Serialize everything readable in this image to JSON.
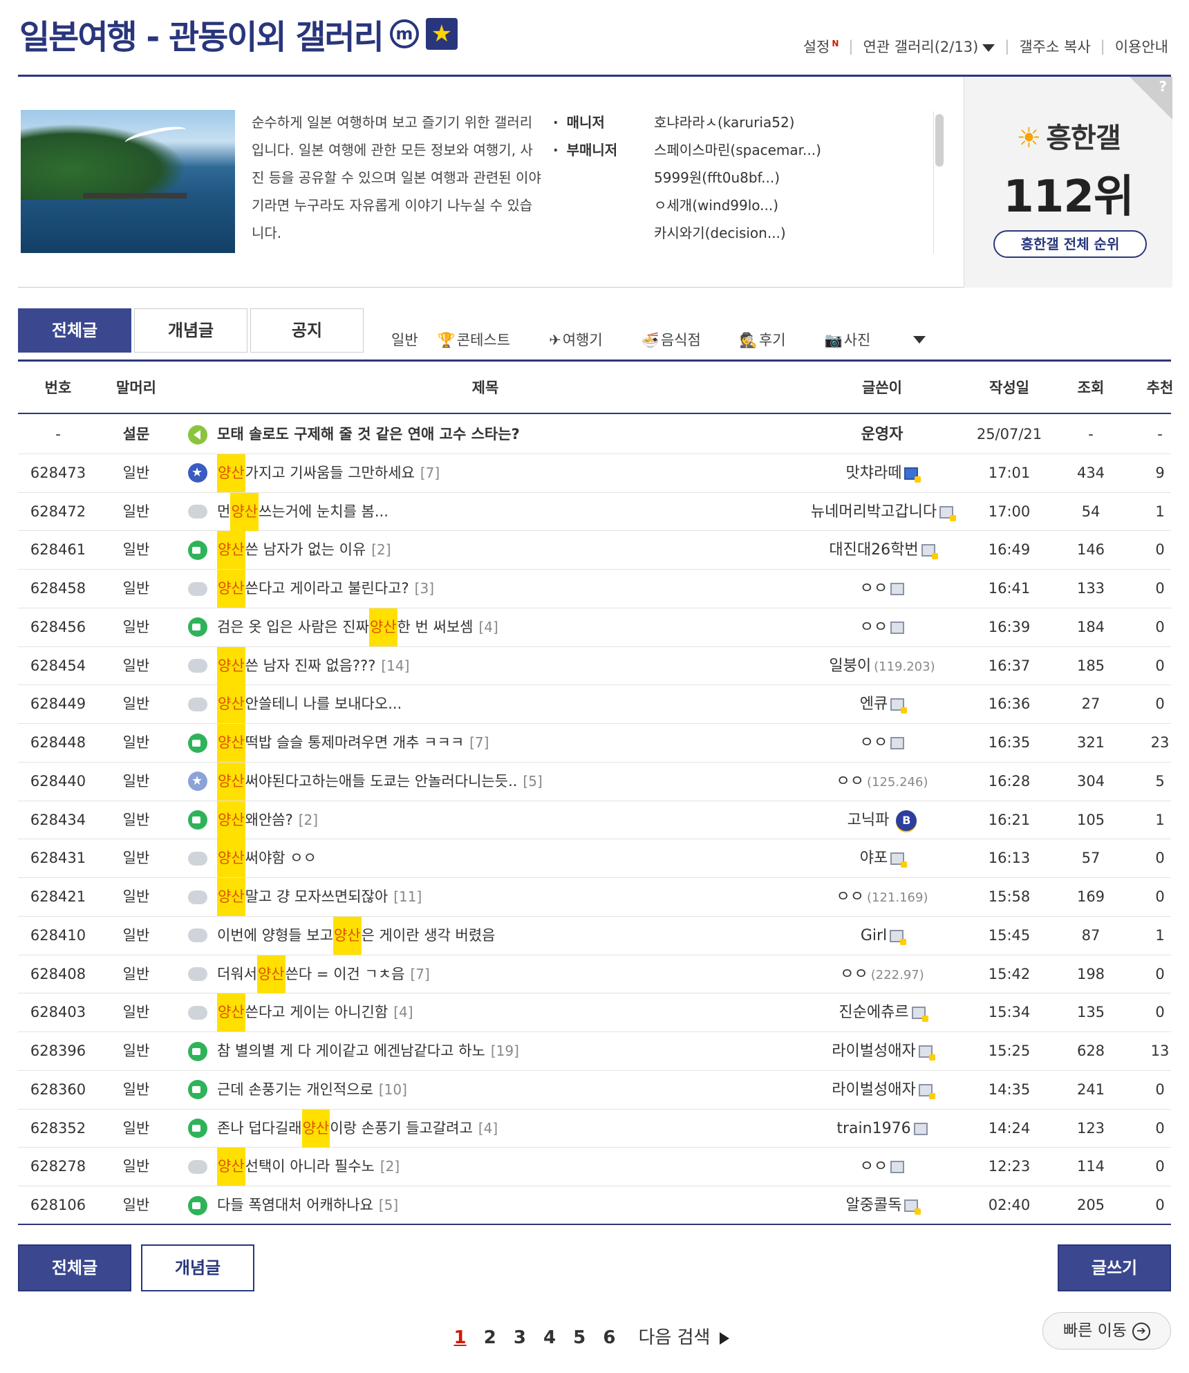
{
  "header": {
    "title": "일본여행 - 관동이외 갤러리",
    "badge_m": "m",
    "badge_star": "★",
    "links": [
      "설정",
      "연관 갤러리(2/13)",
      "갤주소 복사",
      "이용안내"
    ],
    "new_mark": "N",
    "link_sep": "|"
  },
  "info": {
    "description": "순수하게 일본 여행하며 보고 즐기기 위한 갤러리입니다. 일본 여행에 관한 모든 정보와 여행기, 사진 등을 공유할 수 있으며 일본 여행과 관련된 이야기라면 누구라도 자유롭게 이야기 나누실 수 있습니다.",
    "manager_label": "매니저",
    "submanager_label": "부매니저",
    "managers": [
      "호냐라라ㅅ(karuria52)",
      "스페이스마린(spacemar...)",
      "5999원(fft0u8bf...)",
      "ㅇ세개(wind99lo...)",
      "카시와기(decision...)"
    ]
  },
  "rank": {
    "question": "?",
    "sun_icon": "☀",
    "name": "흥한갤",
    "number": "112위",
    "button": "흥한갤 전체 순위"
  },
  "tabs": [
    "전체글",
    "개념글",
    "공지"
  ],
  "categories": [
    {
      "icon": "",
      "label": "일반"
    },
    {
      "icon": "🏆",
      "label": "콘테스트"
    },
    {
      "icon": "✈",
      "label": "여행기"
    },
    {
      "icon": "🍜",
      "label": "음식점"
    },
    {
      "icon": "🕵",
      "label": "후기"
    },
    {
      "icon": "📷",
      "label": "사진"
    }
  ],
  "table": {
    "headers": {
      "no": "번호",
      "head": "말머리",
      "title": "제목",
      "writer": "글쓴이",
      "date": "작성일",
      "views": "조회",
      "rec": "추천"
    },
    "rows": [
      {
        "no": "-",
        "head": "설문",
        "icon": "speaker",
        "pre": "",
        "hl": "",
        "post": "모태 솔로도 구제해 줄 것 같은 연애 고수 스타는?",
        "cmt": "",
        "writer": "운영자",
        "ip": "",
        "fix": "",
        "date": "25/07/21",
        "views": "-",
        "rec": "-",
        "notice": true
      },
      {
        "no": "628473",
        "head": "일반",
        "icon": "star",
        "pre": "",
        "hl": "양산",
        "post": "가지고 기싸움들 그만하세요",
        "cmt": "[7]",
        "writer": "맛챠라떼",
        "ip": "",
        "fix": "blue",
        "date": "17:01",
        "views": "434",
        "rec": "9"
      },
      {
        "no": "628472",
        "head": "일반",
        "icon": "chat",
        "pre": "먼 ",
        "hl": "양산",
        "post": "쓰는거에 눈치를 봄...",
        "cmt": "",
        "writer": "뉴네머리박고갑니다",
        "ip": "",
        "fix": "yellow",
        "date": "17:00",
        "views": "54",
        "rec": "1"
      },
      {
        "no": "628461",
        "head": "일반",
        "icon": "pic",
        "pre": "",
        "hl": "양산",
        "post": " 쓴 남자가 없는 이유",
        "cmt": "[2]",
        "writer": "대진대26학번",
        "ip": "",
        "fix": "yellow",
        "date": "16:49",
        "views": "146",
        "rec": "0"
      },
      {
        "no": "628458",
        "head": "일반",
        "icon": "chat",
        "pre": "",
        "hl": "양산",
        "post": " 쓴다고 게이라고 불린다고?",
        "cmt": "[3]",
        "writer": "ㅇㅇ",
        "ip": "",
        "fix": "gray",
        "date": "16:41",
        "views": "133",
        "rec": "0"
      },
      {
        "no": "628456",
        "head": "일반",
        "icon": "pic",
        "pre": "검은 옷 입은 사람은 진짜 ",
        "hl": "양산",
        "post": " 한 번 써보셈",
        "cmt": "[4]",
        "writer": "ㅇㅇ",
        "ip": "",
        "fix": "gray",
        "date": "16:39",
        "views": "184",
        "rec": "0"
      },
      {
        "no": "628454",
        "head": "일반",
        "icon": "chat",
        "pre": "",
        "hl": "양산",
        "post": " 쓴 남자 진짜 없음???",
        "cmt": "[14]",
        "writer": "일붕이",
        "ip": "(119.203)",
        "fix": "",
        "date": "16:37",
        "views": "185",
        "rec": "0"
      },
      {
        "no": "628449",
        "head": "일반",
        "icon": "chat",
        "pre": "",
        "hl": "양산",
        "post": "안쓸테니 나를 보내다오...",
        "cmt": "",
        "writer": "엔큐",
        "ip": "",
        "fix": "yellow",
        "date": "16:36",
        "views": "27",
        "rec": "0"
      },
      {
        "no": "628448",
        "head": "일반",
        "icon": "pic",
        "pre": "",
        "hl": "양산",
        "post": " 떡밥 슬슬 통제마려우면 개추 ㅋㅋㅋ",
        "cmt": "[7]",
        "writer": "ㅇㅇ",
        "ip": "",
        "fix": "gray",
        "date": "16:35",
        "views": "321",
        "rec": "23"
      },
      {
        "no": "628440",
        "head": "일반",
        "icon": "star-light",
        "pre": "",
        "hl": "양산",
        "post": "써야된다고하는애들 도쿄는 안놀러다니는듯..",
        "cmt": "[5]",
        "writer": "ㅇㅇ",
        "ip": "(125.246)",
        "fix": "",
        "date": "16:28",
        "views": "304",
        "rec": "5"
      },
      {
        "no": "628434",
        "head": "일반",
        "icon": "pic",
        "pre": "",
        "hl": "양산",
        "post": " 왜안씀?",
        "cmt": "[2]",
        "writer": "고닉파",
        "ip": "",
        "fix": "",
        "badge": "B",
        "date": "16:21",
        "views": "105",
        "rec": "1"
      },
      {
        "no": "628431",
        "head": "일반",
        "icon": "chat",
        "pre": "",
        "hl": "양산",
        "post": " 써야함 ㅇㅇ",
        "cmt": "",
        "writer": "야포",
        "ip": "",
        "fix": "yellow",
        "date": "16:13",
        "views": "57",
        "rec": "0"
      },
      {
        "no": "628421",
        "head": "일반",
        "icon": "chat",
        "pre": "",
        "hl": "양산",
        "post": "말고 걍 모자쓰면되잖아",
        "cmt": "[11]",
        "writer": "ㅇㅇ",
        "ip": "(121.169)",
        "fix": "",
        "date": "15:58",
        "views": "169",
        "rec": "0"
      },
      {
        "no": "628410",
        "head": "일반",
        "icon": "chat",
        "pre": "이번에 양형들 보고 ",
        "hl": "양산",
        "post": "은 게이란 생각 버렸음",
        "cmt": "",
        "writer": "Girl",
        "ip": "",
        "fix": "yellow",
        "date": "15:45",
        "views": "87",
        "rec": "1"
      },
      {
        "no": "628408",
        "head": "일반",
        "icon": "chat",
        "pre": "더워서 ",
        "hl": "양산",
        "post": "쓴다 = 이건 ㄱㅊ음",
        "cmt": "[7]",
        "writer": "ㅇㅇ",
        "ip": "(222.97)",
        "fix": "",
        "date": "15:42",
        "views": "198",
        "rec": "0"
      },
      {
        "no": "628403",
        "head": "일반",
        "icon": "chat",
        "pre": "",
        "hl": "양산",
        "post": " 쓴다고 게이는 아니긴함",
        "cmt": "[4]",
        "writer": "진순에츄르",
        "ip": "",
        "fix": "yellow",
        "date": "15:34",
        "views": "135",
        "rec": "0"
      },
      {
        "no": "628396",
        "head": "일반",
        "icon": "pic",
        "pre": "참 별의별 게 다 게이같고 에겐남같다고 하노",
        "hl": "",
        "post": "",
        "cmt": "[19]",
        "writer": "라이벌성애자",
        "ip": "",
        "fix": "yellow",
        "date": "15:25",
        "views": "628",
        "rec": "13"
      },
      {
        "no": "628360",
        "head": "일반",
        "icon": "pic",
        "pre": "근데 손풍기는 개인적으로",
        "hl": "",
        "post": "",
        "cmt": "[10]",
        "writer": "라이벌성애자",
        "ip": "",
        "fix": "yellow",
        "date": "14:35",
        "views": "241",
        "rec": "0"
      },
      {
        "no": "628352",
        "head": "일반",
        "icon": "pic",
        "pre": "존나 덥다길래 ",
        "hl": "양산",
        "post": "이랑 손풍기 들고갈려고",
        "cmt": "[4]",
        "writer": "train1976",
        "ip": "",
        "fix": "gray",
        "date": "14:24",
        "views": "123",
        "rec": "0"
      },
      {
        "no": "628278",
        "head": "일반",
        "icon": "chat",
        "pre": "",
        "hl": "양산",
        "post": " 선택이 아니라 필수노",
        "cmt": "[2]",
        "writer": "ㅇㅇ",
        "ip": "",
        "fix": "gray",
        "date": "12:23",
        "views": "114",
        "rec": "0"
      },
      {
        "no": "628106",
        "head": "일반",
        "icon": "pic",
        "pre": "다들 폭염대처 어캐하나요",
        "hl": "",
        "post": "",
        "cmt": "[5]",
        "writer": "알중콜독",
        "ip": "",
        "fix": "yellow",
        "date": "02:40",
        "views": "205",
        "rec": "0"
      }
    ]
  },
  "bottom": {
    "tabs": [
      "전체글",
      "개념글"
    ],
    "write": "글쓰기",
    "pages": [
      "1",
      "2",
      "3",
      "4",
      "5",
      "6"
    ],
    "next": "다음 검색",
    "quick": "빠른 이동",
    "quick_arrow": "➔"
  }
}
